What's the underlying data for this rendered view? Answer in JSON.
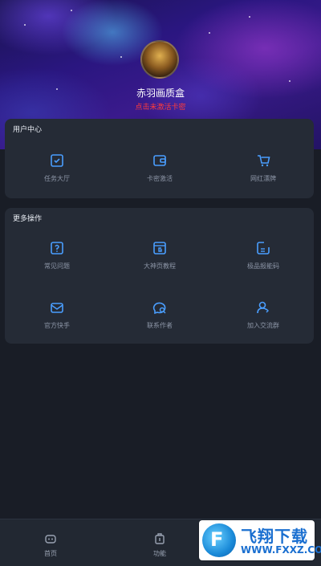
{
  "profile": {
    "username": "赤羽画质盒",
    "subtitle": "点击未激活卡密"
  },
  "user_center": {
    "title": "用户中心",
    "items": [
      {
        "label": "任务大厅",
        "icon": "task-list-icon"
      },
      {
        "label": "卡密激活",
        "icon": "wallet-icon"
      },
      {
        "label": "网红漂牌",
        "icon": "cart-icon"
      }
    ]
  },
  "more_actions": {
    "title": "更多操作",
    "items": [
      {
        "label": "常见问题",
        "icon": "question-icon"
      },
      {
        "label": "大神页教程",
        "icon": "guide-icon"
      },
      {
        "label": "极品报能码",
        "icon": "edit-note-icon"
      },
      {
        "label": "官方快手",
        "icon": "mail-icon"
      },
      {
        "label": "联系作者",
        "icon": "chat-search-icon"
      },
      {
        "label": "加入交流群",
        "icon": "user-group-icon"
      }
    ]
  },
  "tabs": [
    {
      "label": "首页",
      "icon": "home-icon"
    },
    {
      "label": "功能",
      "icon": "function-icon"
    }
  ],
  "watermark": {
    "title": "飞翔下载",
    "url": "WWW.FXXZ.COM"
  },
  "colors": {
    "background": "#191d26",
    "card": "#252b36",
    "accent_icon": "#4a9eff",
    "subtitle_red": "#ff3b3b"
  }
}
